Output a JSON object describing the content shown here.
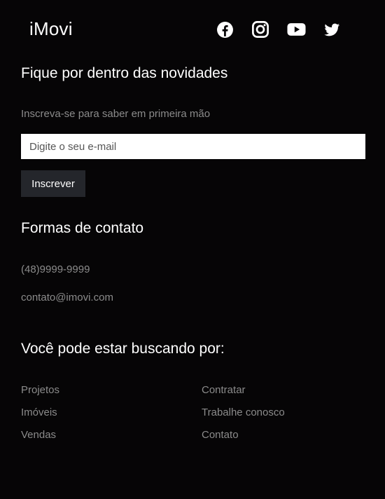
{
  "header": {
    "brand": "iMovi",
    "social_icons": [
      "facebook-icon",
      "instagram-icon",
      "youtube-icon",
      "twitter-icon"
    ]
  },
  "newsletter": {
    "title": "Fique por dentro das novidades",
    "text": "Inscreva-se para saber em primeira mão",
    "email_placeholder": "Digite o seu e-mail",
    "email_value": "",
    "button_label": "Inscrever"
  },
  "contact": {
    "title": "Formas de contato",
    "phone": "(48)9999-9999",
    "email": "contato@imovi.com"
  },
  "search": {
    "title": "Você pode estar buscando por:",
    "links_left": [
      "Projetos",
      "Imóveis",
      "Vendas"
    ],
    "links_right": [
      "Contratar",
      "Trabalhe conosco",
      "Contato"
    ]
  },
  "colors": {
    "background": "#060506",
    "text": "#ffffff",
    "muted_text": "#8b8b8b",
    "button_background": "#24262b",
    "input_background": "#ffffff"
  }
}
